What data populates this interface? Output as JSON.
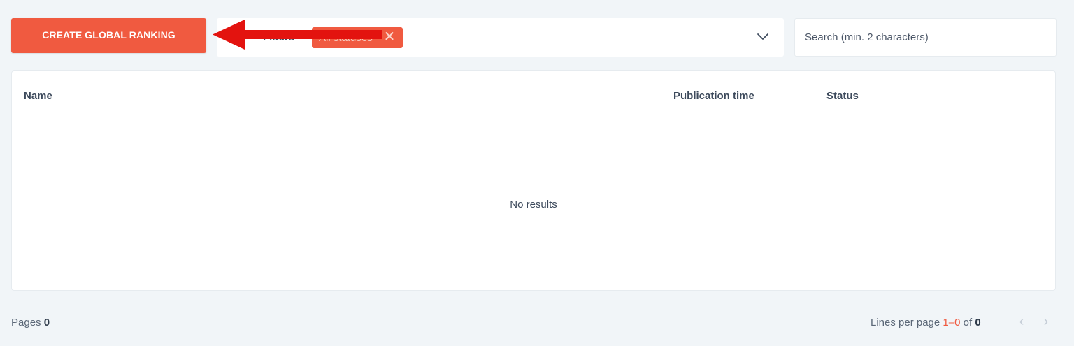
{
  "toolbar": {
    "create_label": "CREATE GLOBAL RANKING"
  },
  "filters": {
    "label": "Filters",
    "chip_label": "All statuses",
    "chip_close_icon": "close-icon",
    "chevron_icon": "chevron-down-icon"
  },
  "search": {
    "placeholder": "Search (min. 2 characters)",
    "value": ""
  },
  "table": {
    "columns": [
      "Name",
      "Publication time",
      "Status"
    ],
    "rows": [],
    "empty_text": "No results"
  },
  "footer": {
    "pages_label": "Pages",
    "pages_count": "0",
    "lines_label": "Lines per page",
    "range": "1–0",
    "of_label": "of",
    "total": "0",
    "prev_icon": "chevron-left-icon",
    "next_icon": "chevron-right-icon"
  },
  "colors": {
    "accent": "#f05a40",
    "background": "#f1f5f8",
    "annotation_arrow": "#e3130f"
  }
}
